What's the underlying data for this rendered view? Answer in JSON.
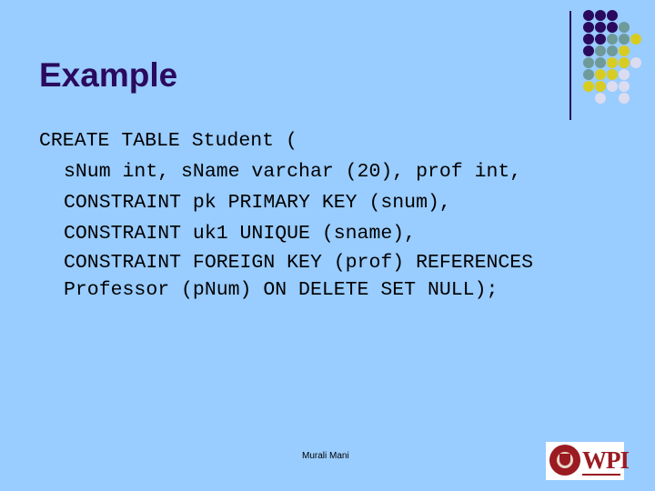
{
  "slide": {
    "title": "Example",
    "code_lines": [
      "CREATE TABLE Student (",
      "sNum int, sName varchar (20), prof int,",
      "CONSTRAINT pk PRIMARY KEY (snum),",
      "CONSTRAINT uk1 UNIQUE (sname),",
      "CONSTRAINT FOREIGN KEY (prof) REFERENCES",
      "Professor (pNum) ON DELETE SET NULL);"
    ],
    "footer": "Murali Mani",
    "logo": {
      "text": "WPI",
      "icon": "wpi-seal-icon"
    }
  },
  "decoration": {
    "colors": {
      "P": "#2a0a5e",
      "T": "#6e9a9a",
      "Y": "#d8cc22",
      "L": "#dcdcf0",
      "background": "#99ccff",
      "title": "#2a0a5e"
    },
    "dot_grid": [
      "PPP__",
      "PPPT_",
      "PPTTY",
      "PTTY_",
      "TTYYL",
      "TYYL_",
      "YYLL_",
      "_L_L_"
    ]
  }
}
